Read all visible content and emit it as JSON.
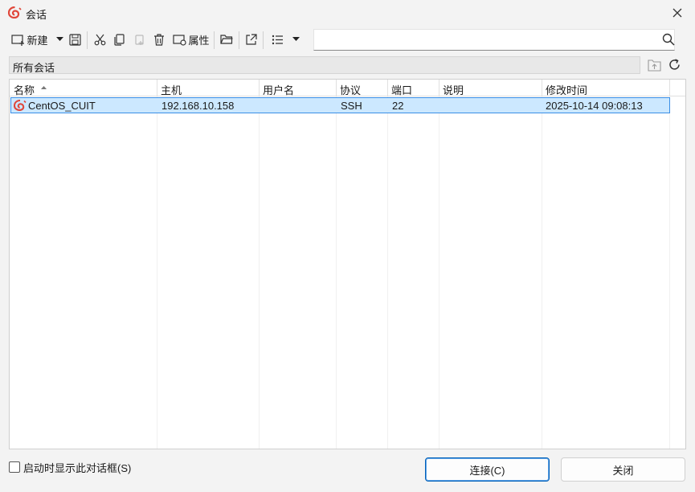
{
  "window": {
    "title": "会话"
  },
  "toolbar": {
    "new_label": "新建",
    "props_label": "属性",
    "search_value": ""
  },
  "breadcrumb": {
    "text": "所有会话"
  },
  "table": {
    "headers": [
      "名称",
      "主机",
      "用户名",
      "协议",
      "端口",
      "说明",
      "修改时间"
    ],
    "rows": [
      {
        "name": "CentOS_CUIT",
        "host": "192.168.10.158",
        "user": "",
        "protocol": "SSH",
        "port": "22",
        "desc": "",
        "modified": "2025-10-14 09:08:13"
      }
    ]
  },
  "footer": {
    "checkbox_label": "启动时显示此对话框(S)",
    "connect_label": "连接(C)",
    "close_label": "关闭"
  },
  "colors": {
    "accent": "#005fb8",
    "selection": "#cce8ff",
    "brand_icon": "#e0473a"
  }
}
